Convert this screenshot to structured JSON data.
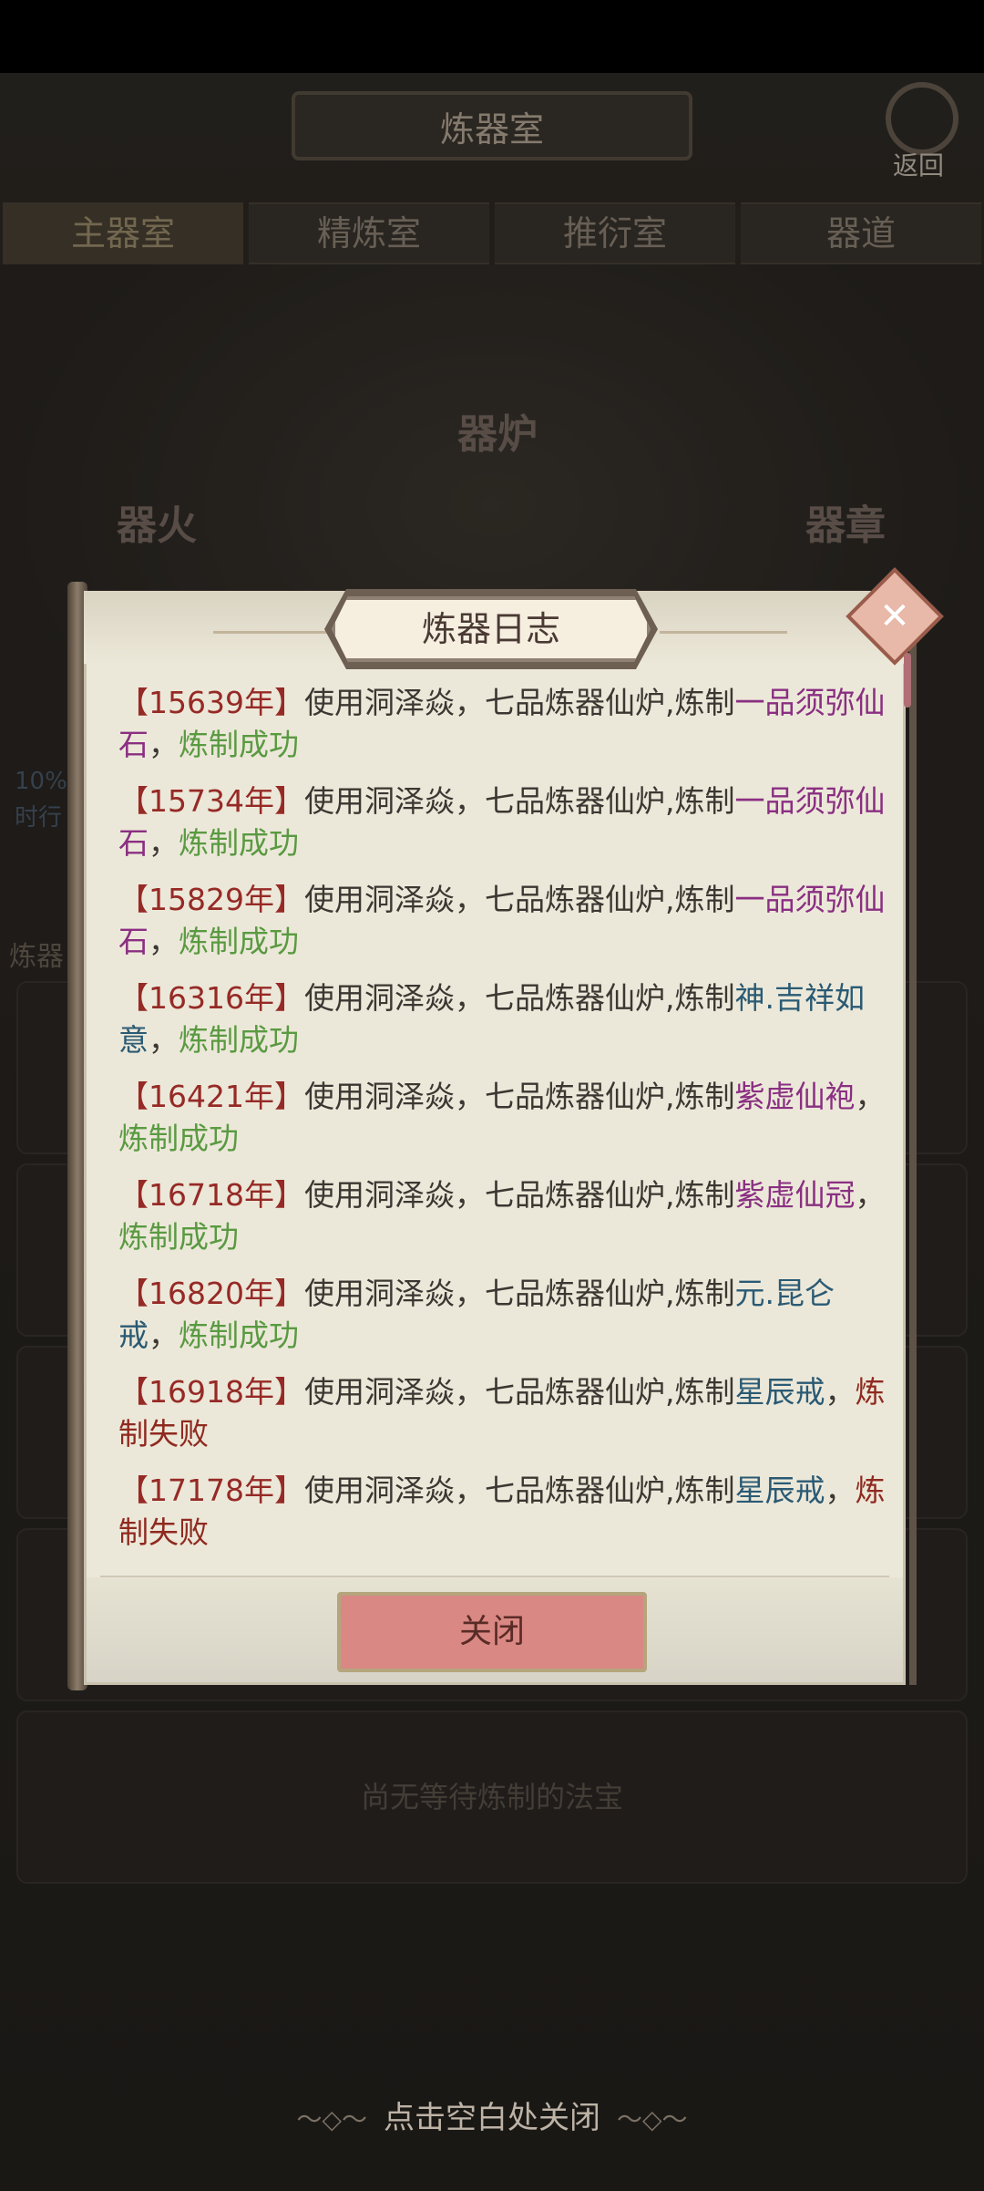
{
  "background": {
    "title": "炼器室",
    "back_label": "返回",
    "tabs": [
      "主器室",
      "精炼室",
      "推衍室",
      "器道"
    ],
    "furnace_label": "器炉",
    "fire_label": "器火",
    "chapter_label": "器章",
    "side_percent": "10%",
    "side_label_frag": "时行",
    "side_label_frag2": "炼器",
    "empty_text": "尚无等待炼制的法宝"
  },
  "modal": {
    "title": "炼器日志",
    "close_button": "关闭",
    "entries": [
      {
        "year": "【15639年】",
        "text": "使用洞泽焱，七品炼器仙炉,炼制",
        "item": "一品须弥仙石",
        "sep": "，",
        "result": "炼制成功",
        "item_color": "purple",
        "result_color": "green"
      },
      {
        "year": "【15734年】",
        "text": "使用洞泽焱，七品炼器仙炉,炼制",
        "item": "一品须弥仙石",
        "sep": "，",
        "result": "炼制成功",
        "item_color": "purple",
        "result_color": "green"
      },
      {
        "year": "【15829年】",
        "text": "使用洞泽焱，七品炼器仙炉,炼制",
        "item": "一品须弥仙石",
        "sep": "，",
        "result": "炼制成功",
        "item_color": "purple",
        "result_color": "green"
      },
      {
        "year": "【16316年】",
        "text": "使用洞泽焱，七品炼器仙炉,炼制",
        "item": "神.吉祥如意",
        "sep": "，",
        "result": "炼制成功",
        "item_color": "teal",
        "result_color": "green"
      },
      {
        "year": "【16421年】",
        "text": "使用洞泽焱，七品炼器仙炉,炼制",
        "item": "紫虚仙袍",
        "sep": "，",
        "result": "炼制成功",
        "item_color": "purple",
        "result_color": "green"
      },
      {
        "year": "【16718年】",
        "text": "使用洞泽焱，七品炼器仙炉,炼制",
        "item": "紫虚仙冠",
        "sep": "，",
        "result": "炼制成功",
        "item_color": "purple",
        "result_color": "green"
      },
      {
        "year": "【16820年】",
        "text": "使用洞泽焱，七品炼器仙炉,炼制",
        "item": "元.昆仑戒",
        "sep": "，",
        "result": "炼制成功",
        "item_color": "teal",
        "result_color": "green"
      },
      {
        "year": "【16918年】",
        "text": "使用洞泽焱，七品炼器仙炉,炼制",
        "item": "星辰戒",
        "sep": "，",
        "result": "炼制失败",
        "item_color": "teal",
        "result_color": "red"
      },
      {
        "year": "【17178年】",
        "text": "使用洞泽焱，七品炼器仙炉,炼制",
        "item": "星辰戒",
        "sep": "，",
        "result": "炼制失败",
        "item_color": "teal",
        "result_color": "red"
      }
    ]
  },
  "bottom_hint": "点击空白处关闭",
  "colors": {
    "year": "#962a26",
    "purple": "#8a2f82",
    "teal": "#2a5a74",
    "green": "#5a9a42",
    "red": "#8f2a20",
    "close_button": "#d98884"
  }
}
